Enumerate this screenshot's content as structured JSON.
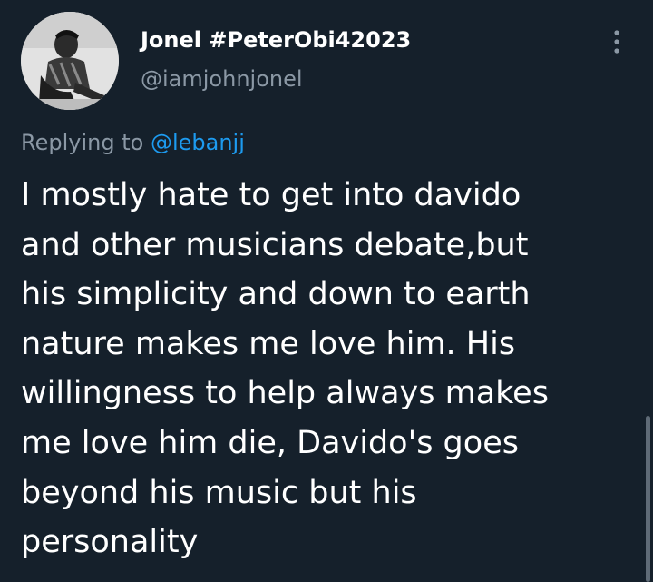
{
  "author": {
    "display_name": "Jonel #PeterObi42023",
    "handle": "@iamjohnjonel",
    "avatar_icon": "profile-photo"
  },
  "reply": {
    "prefix": "Replying to",
    "mention": "@lebanjj"
  },
  "tweet": {
    "lines": [
      "I mostly hate to get into davido",
      "and other musicians debate,but",
      "his simplicity and down to earth",
      "nature makes me love him. His",
      "willingness to help always makes",
      "me love him die, Davido's goes",
      "beyond his music but his",
      "personality"
    ]
  },
  "more_icon": "more-vertical-icon",
  "colors": {
    "background": "#15202b",
    "secondary_text": "#8b98a5",
    "link": "#1d9bf0"
  }
}
